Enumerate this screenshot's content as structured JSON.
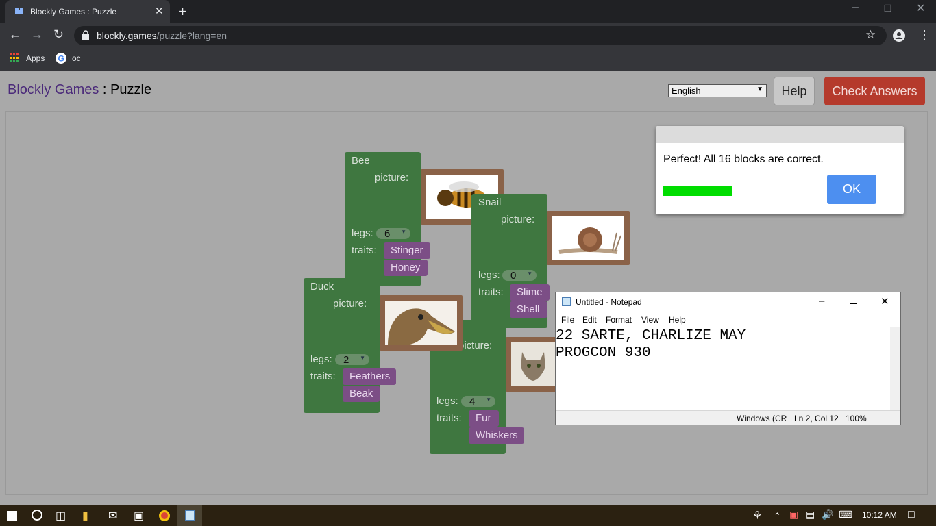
{
  "browser": {
    "tab_title": "Blockly Games : Puzzle",
    "tab_close": "✕",
    "new_tab": "+",
    "url_host": "blockly.games",
    "url_path": "/puzzle?lang=en",
    "bookmarks": [
      {
        "label": "Apps",
        "icon": "apps-grid-icon"
      },
      {
        "label": "oc",
        "icon": "google-icon"
      }
    ]
  },
  "page": {
    "brand": "Blockly Games",
    "separator": " : ",
    "title": "Puzzle",
    "language_selected": "English",
    "help_label": "Help",
    "check_label": "Check Answers"
  },
  "blocks": {
    "picture_label": "picture:",
    "legs_label": "legs:",
    "traits_label": "traits:",
    "bee": {
      "name": "Bee",
      "legs": "6",
      "traits": [
        "Stinger",
        "Honey"
      ]
    },
    "snail": {
      "name": "Snail",
      "legs": "0",
      "traits": [
        "Slime",
        "Shell"
      ]
    },
    "duck": {
      "name": "Duck",
      "legs": "2",
      "traits": [
        "Feathers",
        "Beak"
      ]
    },
    "cat": {
      "name": "",
      "legs": "4",
      "traits": [
        "Fur",
        "Whiskers"
      ]
    }
  },
  "dialog": {
    "message": "Perfect! All 16 blocks are correct.",
    "ok_label": "OK",
    "progress": 1.0
  },
  "notepad": {
    "title": "Untitled - Notepad",
    "menu": [
      "File",
      "Edit",
      "Format",
      "View",
      "Help"
    ],
    "text": "22 SARTE, CHARLIZE MAY\nPROGCON 930",
    "status_encoding": "Windows (CR",
    "status_position": "Ln 2, Col 12",
    "status_zoom": "100%"
  },
  "taskbar": {
    "time": "10:12 AM"
  },
  "colors": {
    "block_green": "#3f7740",
    "trait_purple": "#7c4e86",
    "check_red": "#b53a2c",
    "ok_blue": "#4d8ff0",
    "progress_green": "#00dd00"
  }
}
